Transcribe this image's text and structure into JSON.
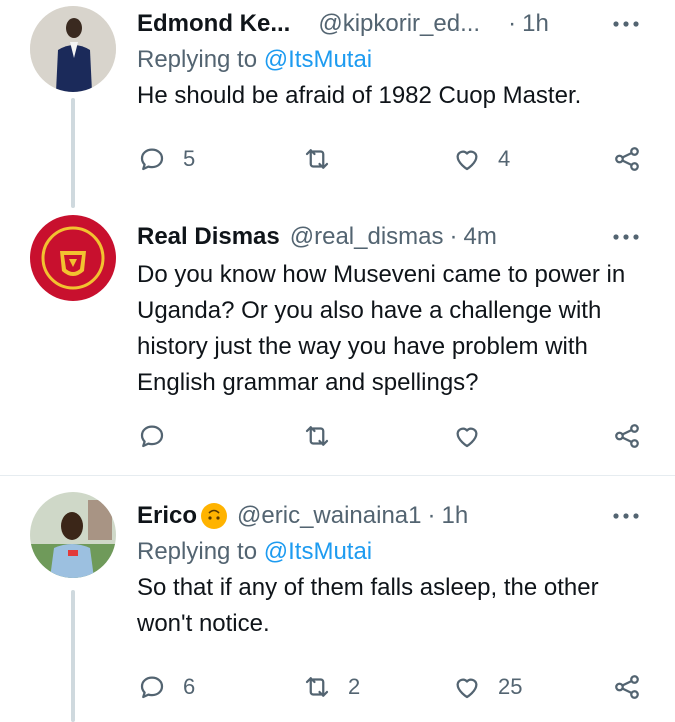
{
  "tweets": [
    {
      "name": "Edmond Ke...",
      "handle": "@kipkorir_ed...",
      "dot": "·",
      "time": "1h",
      "reply_prefix": "Replying to",
      "reply_to": "@ItsMutai",
      "text": "He should be afraid of 1982 Cuop Master.",
      "replies": "5",
      "retweets": "",
      "likes": "4"
    },
    {
      "name": "Real Dismas",
      "handle": "@real_dismas",
      "dot": "·",
      "time": "4m",
      "text": "Do you know how Museveni came to power in Uganda? Or you also have a challenge with history just the way you have problem with English grammar and spellings?",
      "replies": "",
      "retweets": "",
      "likes": ""
    },
    {
      "name": "Erico",
      "handle": "@eric_wainaina1",
      "dot": "·",
      "time": "1h",
      "reply_prefix": "Replying to",
      "reply_to": "@ItsMutai",
      "text": "So that if any of them falls asleep, the other won't notice.",
      "replies": "6",
      "retweets": "2",
      "likes": "25"
    }
  ],
  "colors": {
    "text": "#0f1419",
    "secondary": "#536471",
    "link": "#1d9bf0",
    "thread": "#cfd9de"
  }
}
